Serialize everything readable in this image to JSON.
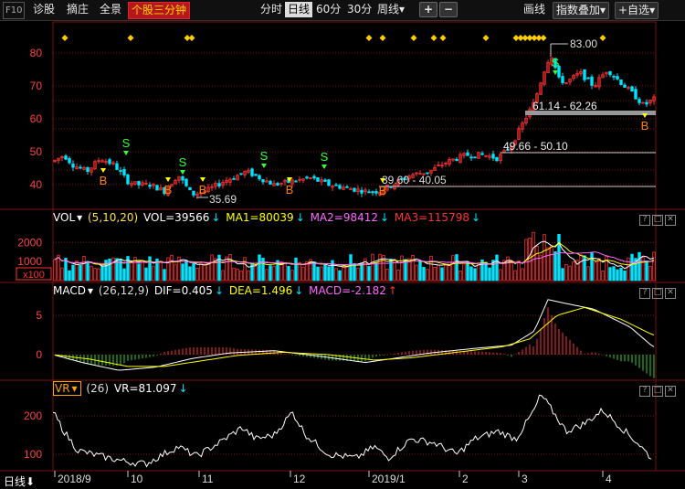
{
  "toolbar": {
    "f10": "F10",
    "tab1": "诊股",
    "tab2": "摘庄",
    "tab3": "全景",
    "active_tab": "个股三分钟",
    "periods": [
      "分时",
      "日线",
      "60分",
      "30分",
      "周线"
    ],
    "active_period": "日线",
    "period_arrow": "▾",
    "plus": "+",
    "minus": "−",
    "draw": "画线",
    "overlay": "指数叠加",
    "overlay_arrow": "▾",
    "watchlist": "+自选",
    "watchlist_arrow": "▾"
  },
  "price_panel": {
    "y_labels": [
      "80",
      "70",
      "60",
      "50",
      "40"
    ],
    "annotations": {
      "high": "83.00",
      "range1": "61.14 - 62.26",
      "range2": "49.66 - 50.10",
      "range3": "39.60 - 40.05",
      "low": "35.69"
    },
    "signal_buy": "B",
    "signal_sell": "S"
  },
  "vol_panel": {
    "name": "VOL",
    "params": "(5,10,20)",
    "vol": "VOL=39566",
    "ma1": "MA1=80039",
    "ma2": "MA2=98412",
    "ma3": "MA3=115798",
    "y_labels": [
      "2000",
      "1000"
    ],
    "unit": "x100"
  },
  "macd_panel": {
    "name": "MACD",
    "params": "(26,12,9)",
    "dif": "DIF=0.405",
    "dea": "DEA=1.496",
    "macd": "MACD=-2.182",
    "y_labels": [
      "5",
      "0"
    ]
  },
  "vr_panel": {
    "name": "VR",
    "params": "(26)",
    "vr": "VR=81.097",
    "y_labels": [
      "200",
      "100"
    ]
  },
  "x_axis": {
    "period_label": "日线",
    "labels": [
      "2018/9",
      "10",
      "11",
      "12",
      "2019/1",
      "2",
      "3",
      "4"
    ]
  },
  "window_buttons": {
    "help": "?",
    "restore": "□",
    "close": "✕"
  },
  "colors": {
    "up": "#ff3232",
    "down": "#00e4ff",
    "grid": "#7a1010",
    "ma1": "#ffffff",
    "ma2": "#ffff00",
    "ma3": "#ff66ff",
    "macd_pos": "#ff3232",
    "macd_neg": "#2fd02f",
    "signal": "#ffcc00",
    "buy": "#ff7f00",
    "sell": "#33ff33"
  }
}
